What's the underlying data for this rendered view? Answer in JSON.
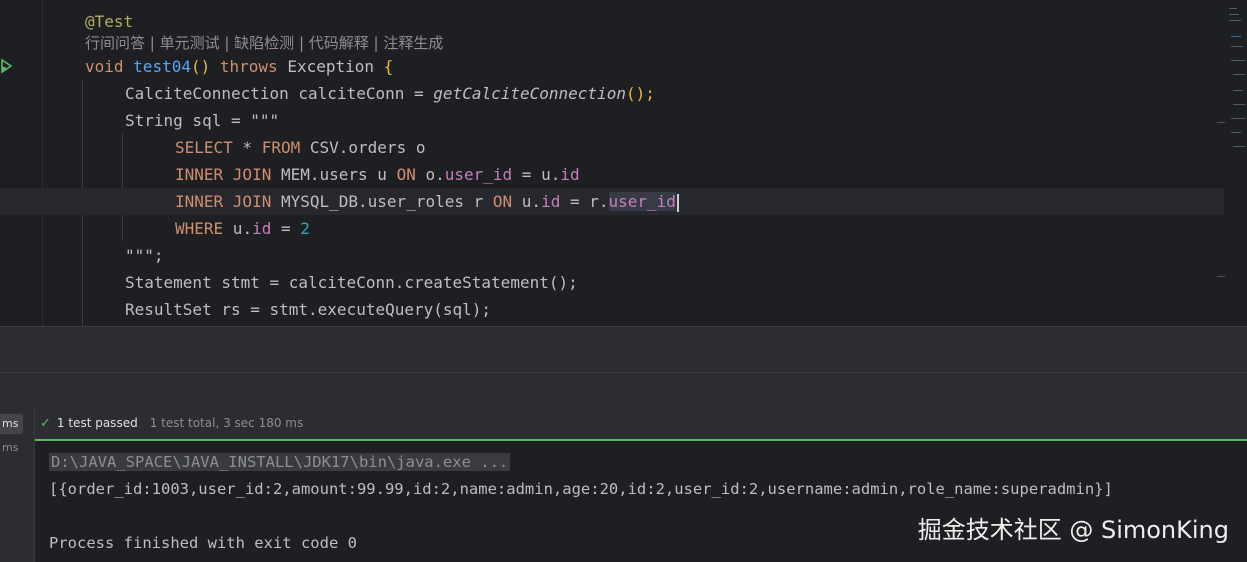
{
  "editor": {
    "annotation": "@Test",
    "inlay_hint": "行间问答 | 单元测试 | 缺陷检测 | 代码解释 | 注释生成",
    "lines": {
      "decl": {
        "void": "void",
        "name": "test04",
        "paren": "()",
        "throws": "throws",
        "exc": "Exception",
        "brace": "{"
      },
      "conn": {
        "type": "CalciteConnection",
        "var": "calciteConn",
        "eq": "=",
        "call": "getCalciteConnection",
        "rest": "();"
      },
      "sqlvar": {
        "text": "String sql = ",
        "str": "\"\"\""
      },
      "sql1": {
        "kw1": "SELECT",
        "mid": " * ",
        "kw2": "FROM",
        "rest": " CSV.orders o"
      },
      "sql2": {
        "kw1": "INNER JOIN",
        "a": " MEM.users u ",
        "kw2": "ON",
        "b": " o.",
        "f1": "user_id",
        "c": " = u.",
        "f2": "id"
      },
      "sql3": {
        "kw1": "INNER JOIN",
        "a": " MYSQL_DB.user_roles r ",
        "kw2": "ON",
        "b": " u.",
        "f1": "id",
        "c": " = r.",
        "f2": "user_id"
      },
      "sql4": {
        "kw1": "WHERE",
        "a": " u.",
        "f1": "id",
        "b": " = ",
        "num": "2"
      },
      "sqlend": {
        "str": "\"\"\"",
        "semi": ";"
      },
      "stmt": {
        "text": "Statement stmt = calciteConn.createStatement();"
      },
      "rs": {
        "text": "ResultSet rs = stmt.executeQuery(sql);"
      }
    }
  },
  "tests": {
    "badges": [
      "ms",
      "ms"
    ],
    "status_icon": "check-icon",
    "passed_label": "1 test passed",
    "summary": "1 test total, 3 sec 180 ms"
  },
  "console": {
    "command": "D:\\JAVA_SPACE\\JAVA_INSTALL\\JDK17\\bin\\java.exe ...",
    "output": "[{order_id:1003,user_id:2,amount:99.99,id:2,name:admin,age:20,id:2,user_id:2,username:admin,role_name:superadmin}]",
    "exit": "Process finished with exit code 0"
  },
  "watermark": "掘金技术社区 @ SimonKing",
  "colors": {
    "pass_green": "#5fb865",
    "keyword": "#cf8e6d",
    "function": "#56a8f5",
    "field": "#c77dbb",
    "number": "#2aacb8",
    "annotation": "#b3ae60"
  }
}
